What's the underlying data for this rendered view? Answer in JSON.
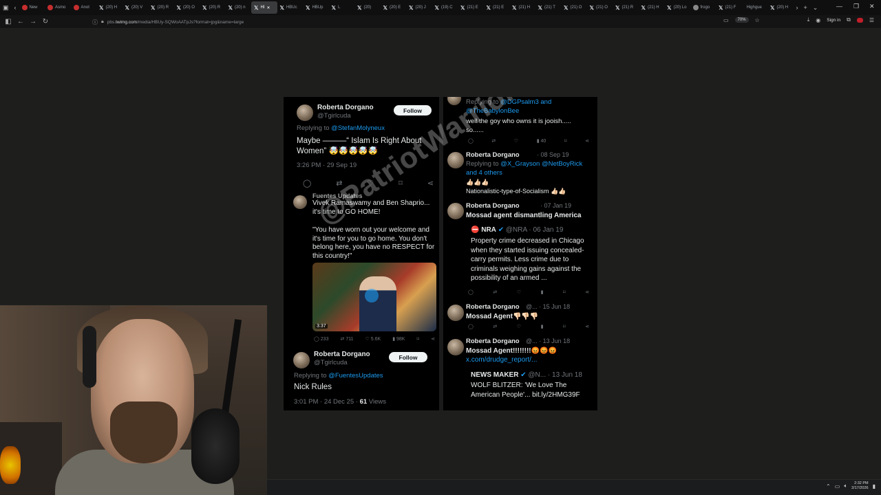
{
  "browser": {
    "tabs": [
      {
        "label": "New",
        "icon": "red"
      },
      {
        "label": "Asmo",
        "icon": "red"
      },
      {
        "label": "Anot",
        "icon": "red"
      },
      {
        "label": "(20) H",
        "icon": "x"
      },
      {
        "label": "(20) V",
        "icon": "x"
      },
      {
        "label": "(20) R",
        "icon": "x"
      },
      {
        "label": "(20) O",
        "icon": "x"
      },
      {
        "label": "(20) R",
        "icon": "x"
      },
      {
        "label": "(20) n",
        "icon": "x"
      },
      {
        "label": "HI",
        "icon": "x",
        "active": true
      },
      {
        "label": "HBUc",
        "icon": "x"
      },
      {
        "label": "HBUp",
        "icon": "x"
      },
      {
        "label": "L",
        "icon": "x"
      },
      {
        "label": "(20)",
        "icon": "x"
      },
      {
        "label": "(20) E",
        "icon": "x"
      },
      {
        "label": "(20) J",
        "icon": "x"
      },
      {
        "label": "(19) C",
        "icon": "x"
      },
      {
        "label": "(21) E",
        "icon": "x"
      },
      {
        "label": "(21) E",
        "icon": "x"
      },
      {
        "label": "(21) H",
        "icon": "x"
      },
      {
        "label": "(21) T",
        "icon": "x"
      },
      {
        "label": "(21) O",
        "icon": "x"
      },
      {
        "label": "(21) O",
        "icon": "x"
      },
      {
        "label": "(21) R",
        "icon": "x"
      },
      {
        "label": "(21) H",
        "icon": "x"
      },
      {
        "label": "(20) Lo",
        "icon": "x"
      },
      {
        "label": "frogo",
        "icon": "grey"
      },
      {
        "label": "(21) F",
        "icon": "x"
      },
      {
        "label": "Highgue",
        "icon": "none"
      },
      {
        "label": "(20) H",
        "icon": "x"
      }
    ],
    "url_prefix": "pbs.",
    "url_host": "twimg.com",
    "url_path": "/media/HBUy-SQWoAATpJs?format=jpg&name=large",
    "zoom": "70%",
    "sign_in": "Sign in"
  },
  "image": {
    "watermark": "@PatriotWarrior",
    "left": {
      "t1": {
        "name": "Roberta Dorgano",
        "handle": "@Tgirlcuda",
        "follow": "Follow",
        "replying_prefix": "Replying to",
        "replying_to": "@StefanMolyneux",
        "text": "Maybe ———“ Islam Is Right About Women” 🤯🤯🤯🤯🤯",
        "time": "3:26 PM · 29 Sep 19"
      },
      "t2": {
        "name": "Fuentes Updates",
        "text": "Vivek Ramaswamy and Ben Shaprio... it's time to GO HOME!",
        "quote": "\"You have worn out your welcome and it's time for you to go home. You don't belong here, you have no RESPECT for this country!\"",
        "duration": "3:37",
        "replies": "233",
        "reposts": "711",
        "likes": "5.6K",
        "views": "98K"
      },
      "t3": {
        "name": "Roberta Dorgano",
        "handle": "@Tgirlcuda",
        "follow": "Follow",
        "replying_prefix": "Replying to",
        "replying_to": "@FuentesUpdates",
        "text": "Nick Rules",
        "time": "3:01 PM · 24 Dec 25 · ",
        "views_count": "61",
        "views_label": " Views"
      }
    },
    "right": {
      "r1": {
        "replying_prefix": "Replying to",
        "replying_to": "@DGPsalm3 and @TheBabylonBee",
        "text": "well the goy  who owns it is jooish..... so......",
        "views": "40"
      },
      "r2": {
        "name": "Roberta Dorgano",
        "date": "· 08 Sep 19",
        "replying_prefix": "Replying to",
        "replying_to": "@X_Grayson @NetBoyRick and 4 others",
        "text": "👍🏻👍🏻👍🏻\nNationalistic-type-of-Socialism 👍🏻👍🏻"
      },
      "r3": {
        "name": "Roberta Dorgano",
        "date": "· 07 Jan 19",
        "text": "Mossad agent dismantling America",
        "quote_name": "NRA",
        "quote_handle": "@NRA · 06 Jan 19",
        "quote_text": "Property crime decreased in Chicago when they started issuing concealed-carry permits. Less crime due to criminals weighing gains against the possibility of an armed ..."
      },
      "r4": {
        "name": "Roberta Dorgano",
        "date": "@... · 15 Jun 18",
        "text": "Mossad Agent👎🏻👎🏻👎🏻"
      },
      "r5": {
        "name": "Roberta Dorgano",
        "date": "@... · 13 Jun 18",
        "text": "Mossad Agent!!!!!!!!😡😡😡",
        "link": "x.com/drudge_report/...",
        "quote_name": "NEWS MAKER",
        "quote_handle": "@N... · 13 Jun 18",
        "quote_text": "WOLF BLITZER: 'We Love The American People'... bit.ly/2HMG39F"
      }
    }
  },
  "tray": {
    "time": "2:32 PM",
    "date": "2/17/2026"
  }
}
